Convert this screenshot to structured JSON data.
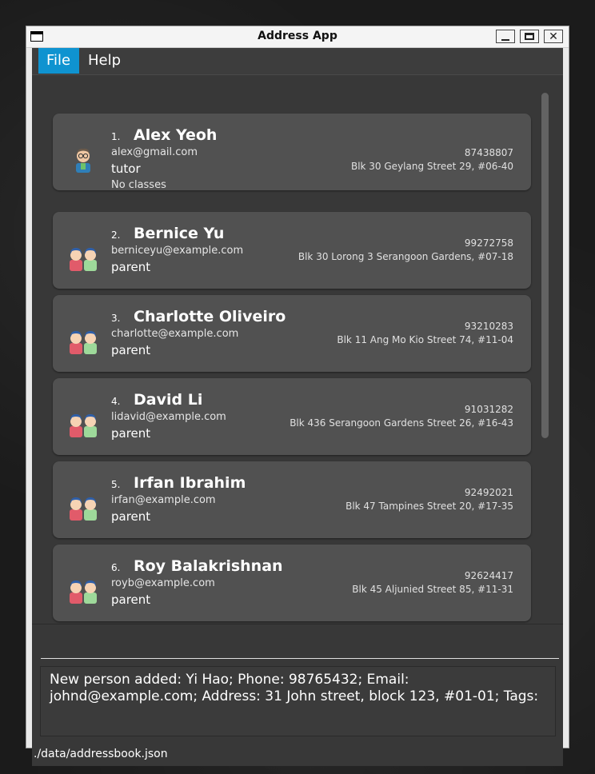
{
  "window": {
    "title": "Address App"
  },
  "menu": {
    "file": "File",
    "help": "Help"
  },
  "persons": [
    {
      "index": "1.",
      "name": "Alex Yeoh",
      "email": "alex@gmail.com",
      "role": "tutor",
      "classes": "No classes",
      "phone": "87438807",
      "address": "Blk 30 Geylang Street 29, #06-40",
      "icon": "tutor-avatar-icon"
    },
    {
      "index": "2.",
      "name": "Bernice Yu",
      "email": "berniceyu@example.com",
      "role": "parent",
      "phone": "99272758",
      "address": "Blk 30 Lorong 3 Serangoon Gardens, #07-18",
      "icon": "parent-avatar-icon"
    },
    {
      "index": "3.",
      "name": "Charlotte Oliveiro",
      "email": "charlotte@example.com",
      "role": "parent",
      "phone": "93210283",
      "address": "Blk 11 Ang Mo Kio Street 74, #11-04",
      "icon": "parent-avatar-icon"
    },
    {
      "index": "4.",
      "name": "David Li",
      "email": "lidavid@example.com",
      "role": "parent",
      "phone": "91031282",
      "address": "Blk 436 Serangoon Gardens Street 26, #16-43",
      "icon": "parent-avatar-icon"
    },
    {
      "index": "5.",
      "name": "Irfan Ibrahim",
      "email": "irfan@example.com",
      "role": "parent",
      "phone": "92492021",
      "address": "Blk 47 Tampines Street 20, #17-35",
      "icon": "parent-avatar-icon"
    },
    {
      "index": "6.",
      "name": "Roy Balakrishnan",
      "email": "royb@example.com",
      "role": "parent",
      "phone": "92624417",
      "address": "Blk 45 Aljunied Street 85, #11-31",
      "icon": "parent-avatar-icon"
    }
  ],
  "command": {
    "value": "",
    "placeholder": ""
  },
  "result": {
    "text": "New person added: Yi Hao; Phone: 98765432; Email: johnd@example.com; Address: 31 John street, block 123, #01-01; Tags:"
  },
  "status": {
    "path": "./data/addressbook.json"
  },
  "colors": {
    "accent": "#0f93d0",
    "card": "#515151",
    "background": "#383838"
  }
}
